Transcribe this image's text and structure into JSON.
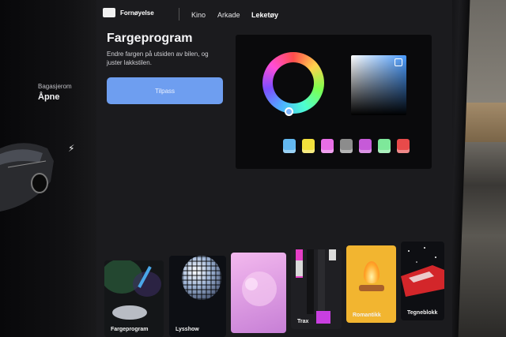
{
  "nav": {
    "section": "Fornøyelse",
    "tabs": [
      {
        "label": "Kino"
      },
      {
        "label": "Arkade"
      },
      {
        "label": "Leketøy",
        "active": true
      }
    ]
  },
  "vehicle": {
    "trunk_label": "Bagasjerom",
    "trunk_value": "Åpne"
  },
  "main": {
    "title": "Fargeprogram",
    "description": "Endre fargen på utsiden av bilen, og juster lakkstilen.",
    "button_label": "Tilpass"
  },
  "picker": {
    "selected_color": "#7fb6ff",
    "swatches": [
      "#63b8f0",
      "#f2e03c",
      "#e86ee6",
      "#8c8c8c",
      "#c65ad8",
      "#7ee89a",
      "#e84a4a"
    ]
  },
  "cards": [
    {
      "label": "Fargeprogram"
    },
    {
      "label": "Lysshow"
    },
    {
      "label": ""
    },
    {
      "label": "Trax"
    },
    {
      "label": "Romantikk"
    },
    {
      "label": "Tegneblokk"
    }
  ]
}
